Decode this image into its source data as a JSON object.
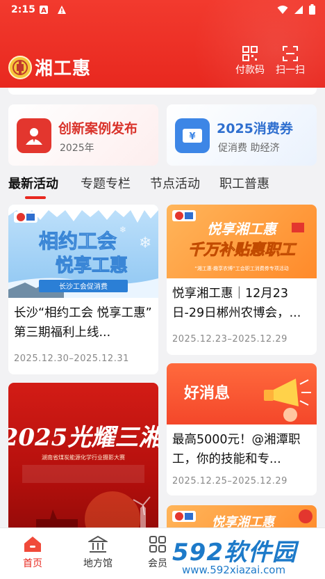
{
  "status": {
    "time": "2:15"
  },
  "header": {
    "app_name": "湘工惠",
    "pay_code_label": "付款码",
    "scan_label": "扫一扫"
  },
  "banners": [
    {
      "title": "创新案例发布",
      "subtitle": "2025年",
      "accent": "#d9332b"
    },
    {
      "title": "2025消费券",
      "subtitle": "促消费 助经济",
      "accent": "#2f6fcf"
    }
  ],
  "tabs": [
    "最新活动",
    "专题专栏",
    "节点活动",
    "职工普惠"
  ],
  "cards": [
    {
      "image_text": [
        "相约工会",
        "悦享工惠"
      ],
      "image_badge": "长沙工会促消费",
      "title": "长沙“相约工会 悦享工惠” 第三期福利上线...",
      "date": "2025.12.30–2025.12.31"
    },
    {
      "image_text": [
        "悦享湘工惠",
        "千万补贴惠职工"
      ],
      "image_badge": "“湘工惠·趣享农博”工会职工消费券专项活动",
      "title": "悦享湘工惠｜12月23日-29日郴州农博会，...",
      "date": "2025.12.23–2025.12.29"
    },
    {
      "image_text": [
        "2025光耀三湘",
        "湖南省煤炭能源化学行业摄影大赛"
      ],
      "title": ""
    },
    {
      "image_text": [
        "好消息"
      ],
      "title": "最高5000元！@湘潭职工，你的技能和专...",
      "date": "2025.12.25–2025.12.29"
    },
    {
      "image_text": [
        "悦享湘工惠"
      ],
      "title": ""
    }
  ],
  "bottom_nav": [
    {
      "label": "首页",
      "icon": "home-icon",
      "active": true
    },
    {
      "label": "地方馆",
      "icon": "building-icon",
      "active": false
    },
    {
      "label": "会员",
      "icon": "grid-icon",
      "active": false
    }
  ],
  "watermark": {
    "brand": "592软件园",
    "url": "www.592xiazai.com"
  },
  "colors": {
    "primary": "#e8281f",
    "blue": "#2f6fcf"
  }
}
